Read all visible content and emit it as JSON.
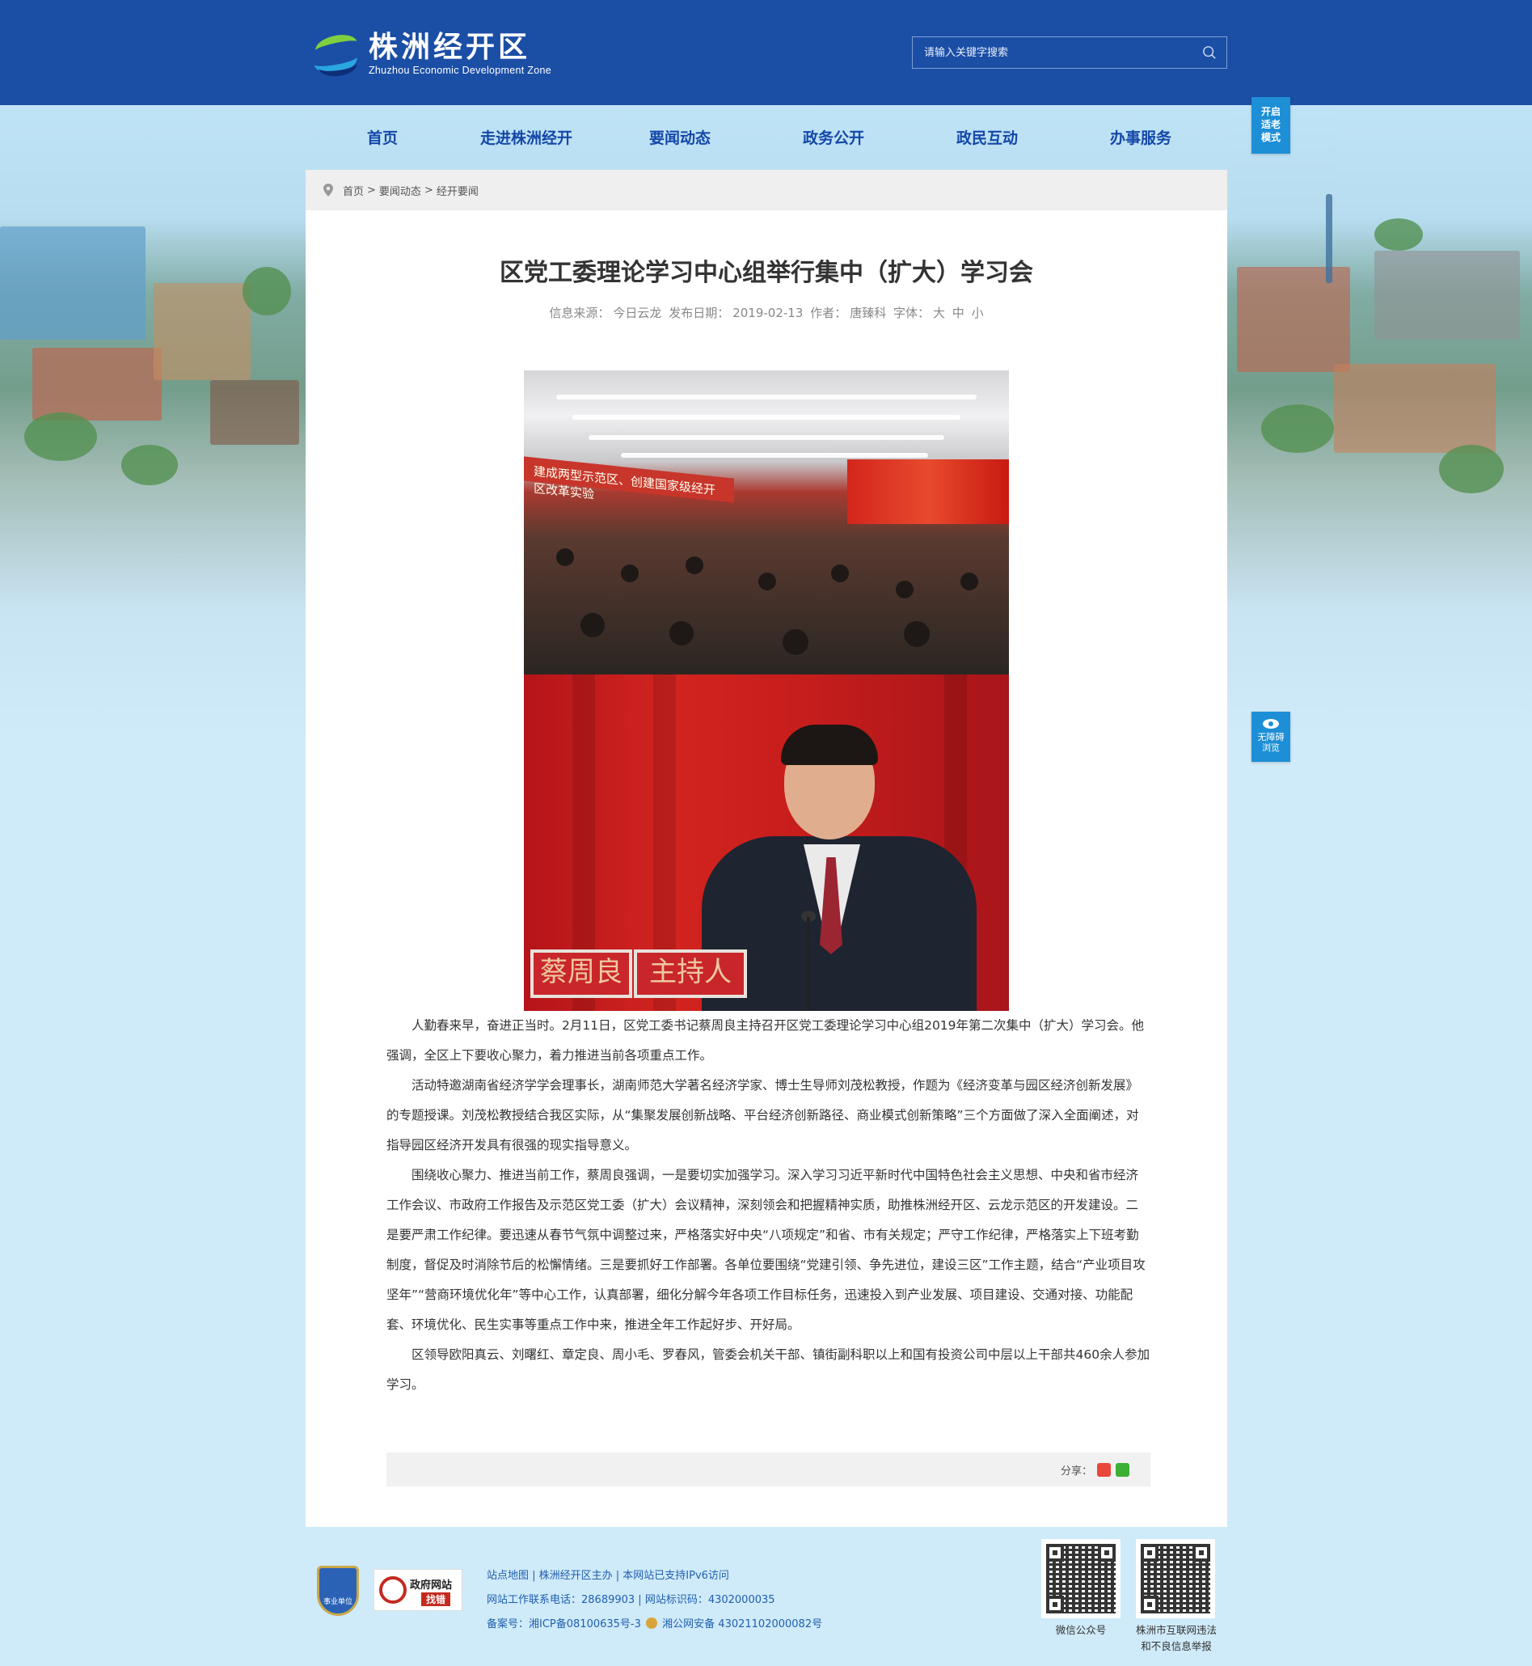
{
  "header": {
    "logo_cn": "株洲经开区",
    "logo_en": "Zhuzhou Economic Development Zone",
    "search_placeholder": "请输入关键字搜索"
  },
  "nav": [
    "首页",
    "走进株洲经开",
    "要闻动态",
    "政务公开",
    "政民互动",
    "办事服务"
  ],
  "side": {
    "elder_mode": [
      "开启",
      "适老",
      "模式"
    ],
    "accessible": [
      "无障碍",
      "浏览"
    ]
  },
  "breadcrumb": [
    "首页",
    ">",
    "要闻动态",
    ">",
    "经开要闻"
  ],
  "article": {
    "title": "区党工委理论学习中心组举行集中（扩大）学习会",
    "meta_source_label": "信息来源：",
    "meta_source": "今日云龙",
    "meta_date_label": "发布日期：",
    "meta_date": "2019-02-13",
    "meta_author_label": "作者：",
    "meta_author": "唐臻科",
    "meta_font_label": "字体：",
    "font_sizes": [
      "大",
      "中",
      "小"
    ],
    "photo_banner": "建成两型示范区、创建国家级经开区改革实验",
    "nameplate_1": "蔡周良",
    "nameplate_2": "主持人",
    "paragraphs": [
      "人勤春来早，奋进正当时。2月11日，区党工委书记蔡周良主持召开区党工委理论学习中心组2019年第二次集中（扩大）学习会。他强调，全区上下要收心聚力，着力推进当前各项重点工作。",
      "活动特邀湖南省经济学学会理事长，湖南师范大学著名经济学家、博士生导师刘茂松教授，作题为《经济变革与园区经济创新发展》的专题授课。刘茂松教授结合我区实际，从“集聚发展创新战略、平台经济创新路径、商业模式创新策略”三个方面做了深入全面阐述，对指导园区经济开发具有很强的现实指导意义。",
      "围绕收心聚力、推进当前工作，蔡周良强调，一是要切实加强学习。深入学习习近平新时代中国特色社会主义思想、中央和省市经济工作会议、市政府工作报告及示范区党工委（扩大）会议精神，深刻领会和把握精神实质，助推株洲经开区、云龙示范区的开发建设。二是要严肃工作纪律。要迅速从春节气氛中调整过来，严格落实好中央“八项规定”和省、市有关规定；严守工作纪律，严格落实上下班考勤制度，督促及时消除节后的松懈情绪。三是要抓好工作部署。各单位要围绕“党建引领、争先进位，建设三区”工作主题，结合“产业项目攻坚年”“营商环境优化年”等中心工作，认真部署，细化分解今年各项工作目标任务，迅速投入到产业发展、项目建设、交通对接、功能配套、环境优化、民生实事等重点工作中来，推进全年工作起好步、开好局。",
      "区领导欧阳真云、刘曙红、章定良、周小毛、罗春风，管委会机关干部、镇街副科职以上和国有投资公司中层以上干部共460余人参加学习。"
    ],
    "share_label": "分享："
  },
  "footer": {
    "badge1": "事业单位",
    "badge2_line1": "政府网站",
    "badge2_line2": "找错",
    "line1": "站点地图 | 株洲经开区主办 | 本网站已支持IPv6访问",
    "line2": "网站工作联系电话：28689903 | 网站标识码：4302000035",
    "line3_a": "备案号：湘ICP备08100635号-3",
    "line3_b": "湘公网安备 43021102000082号",
    "qr1_caption": "微信公众号",
    "qr2_caption_1": "株洲市互联网违法",
    "qr2_caption_2": "和不良信息举报"
  },
  "colors": {
    "header_bg": "#1b4fa6",
    "nav_text": "#1447a8",
    "side_btn": "#1d8fd6",
    "footer_link": "#1f5fae"
  }
}
